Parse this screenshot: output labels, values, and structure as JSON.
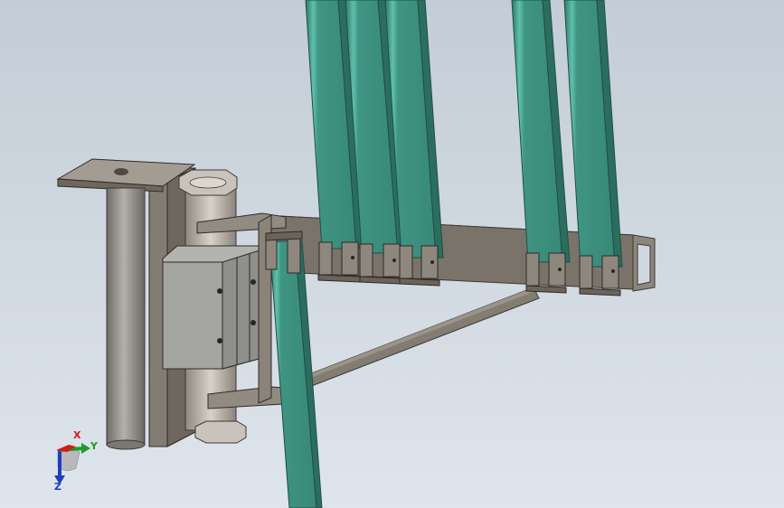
{
  "viewport": {
    "background_top": "#c4cdd7",
    "background_bottom": "#dfe5ec"
  },
  "colors": {
    "steel": "#837c73",
    "steel_dark": "#5f5850",
    "steel_light": "#a39c92",
    "green_profile": "#3f9483",
    "green_edge": "#2a6e61",
    "cylinder": "#9a9690",
    "block": "#a9a9a6"
  },
  "triad": {
    "x_label": "X",
    "y_label": "Y",
    "z_label": "Z",
    "x_color": "#d11c1c",
    "y_color": "#1d9b2a",
    "z_color": "#1d3fbf",
    "icon": "coordinate-triad-icon"
  }
}
